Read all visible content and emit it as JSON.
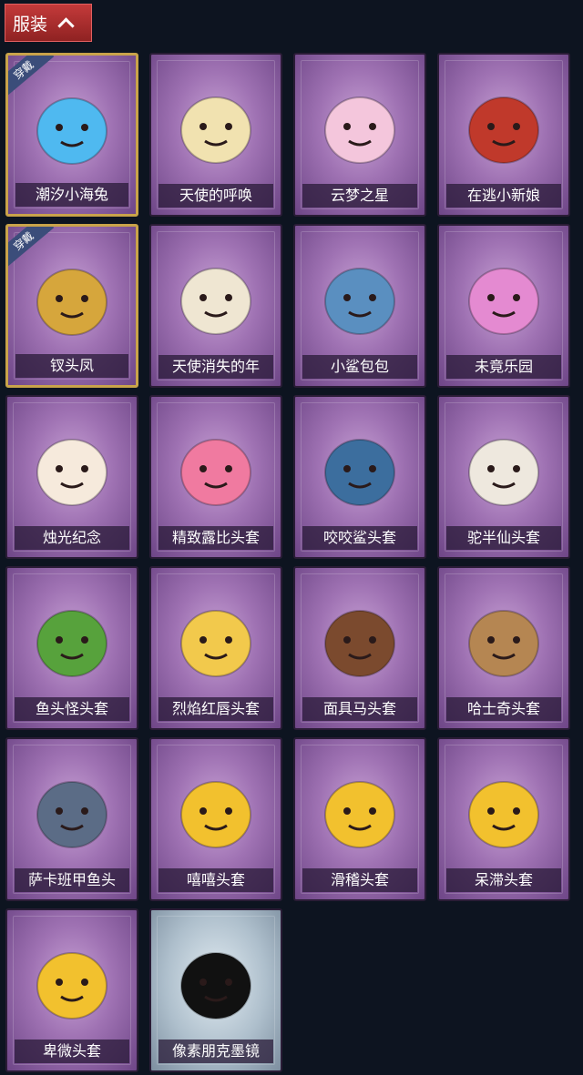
{
  "header": {
    "label": "服装"
  },
  "badge_text": "穿戴",
  "items": [
    {
      "label": "潮汐小海兔",
      "equipped": true,
      "icon": "blue-bunny-icon",
      "color": "#4fb9f0"
    },
    {
      "label": "天使的呼唤",
      "equipped": false,
      "icon": "angel-icon",
      "color": "#f1e2b0"
    },
    {
      "label": "云梦之星",
      "equipped": false,
      "icon": "unicorn-icon",
      "color": "#f4c6dc"
    },
    {
      "label": "在逃小新娘",
      "equipped": false,
      "icon": "red-lamp-icon",
      "color": "#c0392b"
    },
    {
      "label": "钗头凤",
      "equipped": true,
      "icon": "phoenix-crown-icon",
      "color": "#d6a63c"
    },
    {
      "label": "天使消失的年",
      "equipped": false,
      "icon": "veiled-angel-icon",
      "color": "#efe6d2"
    },
    {
      "label": "小鲨包包",
      "equipped": false,
      "icon": "shark-bag-icon",
      "color": "#5a8fc0"
    },
    {
      "label": "未竟乐园",
      "equipped": false,
      "icon": "doll-icon",
      "color": "#e48ad1"
    },
    {
      "label": "烛光纪念",
      "equipped": false,
      "icon": "candle-icon",
      "color": "#f6eadc"
    },
    {
      "label": "精致露比头套",
      "equipped": false,
      "icon": "pink-beaver-icon",
      "color": "#f07aa0"
    },
    {
      "label": "咬咬鲨头套",
      "equipped": false,
      "icon": "shark-head-icon",
      "color": "#3c6e9e"
    },
    {
      "label": "驼半仙头套",
      "equipped": false,
      "icon": "alpaca-icon",
      "color": "#eee8de"
    },
    {
      "label": "鱼头怪头套",
      "equipped": false,
      "icon": "fish-head-icon",
      "color": "#57a23c"
    },
    {
      "label": "烈焰红唇头套",
      "equipped": false,
      "icon": "pikachu-icon",
      "color": "#f2c94c"
    },
    {
      "label": "面具马头套",
      "equipped": false,
      "icon": "horse-head-icon",
      "color": "#7b4a2e"
    },
    {
      "label": "哈士奇头套",
      "equipped": false,
      "icon": "dog-head-icon",
      "color": "#b58652"
    },
    {
      "label": "萨卡班甲鱼头",
      "equipped": false,
      "icon": "whale-icon",
      "color": "#5b6c86"
    },
    {
      "label": "嘻嘻头套",
      "equipped": false,
      "icon": "grin-emoji-icon",
      "color": "#f2c12e"
    },
    {
      "label": "滑稽头套",
      "equipped": false,
      "icon": "smirk-emoji-icon",
      "color": "#f2c12e"
    },
    {
      "label": "呆滞头套",
      "equipped": false,
      "icon": "stare-emoji-icon",
      "color": "#f2c12e"
    },
    {
      "label": "卑微头套",
      "equipped": false,
      "icon": "shy-emoji-icon",
      "color": "#f2c12e"
    },
    {
      "label": "像素朋克墨镜",
      "equipped": false,
      "icon": "pixel-glasses-icon",
      "color": "#111111",
      "silver": true
    }
  ]
}
